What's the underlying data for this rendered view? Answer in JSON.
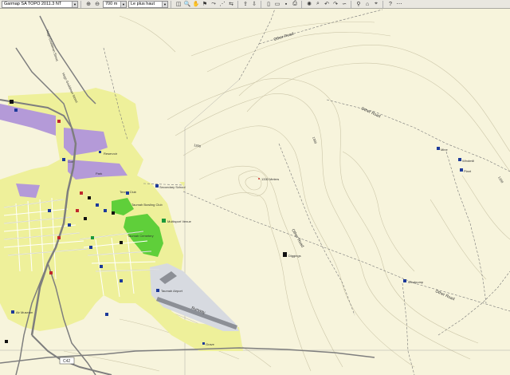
{
  "toolbar": {
    "map_product": "Garmap SA TOPO 2011.3 NT",
    "zoom_scale": "700 m",
    "detail_level": "Le plus haut"
  },
  "map": {
    "labels": {
      "other_road_1": "Other Road",
      "other_road_2": "Other Road",
      "other_road_3": "Other Road",
      "other_road_4": "Other Road",
      "contour_1300_a": "1300",
      "contour_1300_b": "1300",
      "contour_1300_c": "1300",
      "peak": "1330 Meters",
      "runway": "Runway",
      "route_c42": "C42",
      "road_hugo_1": "Hugo Gouldman Street",
      "road_hugo_2": "Hugo Gouldman Street",
      "reservoir": "Reservoir",
      "waypoint_diggings": "Diggings",
      "airport": "Taumah Airport",
      "museum": "Air Museum",
      "multisport": "Multisport Venue",
      "school": "Secondary School",
      "bowling": "Taumah Bowling Club",
      "cemetery": "Taumah Cemetery",
      "poi_east_1": "Mine",
      "poi_east_2": "Windmill",
      "poi_east_3": "Plant",
      "poi_east_4": "Windpump",
      "poi_south": "Grave",
      "golf": "Golf",
      "tennis": "Tennis Club",
      "park": "Park"
    }
  },
  "colors": {
    "land": "#f7f4dc",
    "urban": "#eef09a",
    "industrial": "#b49ad8",
    "park": "#5fcf3a",
    "runway_area": "#cfd3da"
  }
}
